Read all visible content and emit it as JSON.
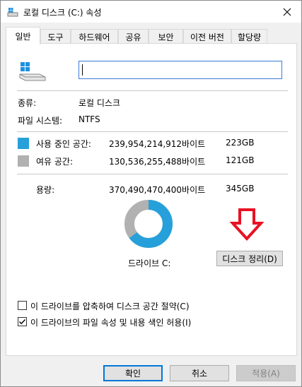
{
  "window": {
    "title": "로컬 디스크 (C:) 속성"
  },
  "tabs": [
    {
      "label": "일반",
      "active": true
    },
    {
      "label": "도구",
      "active": false
    },
    {
      "label": "하드웨어",
      "active": false
    },
    {
      "label": "공유",
      "active": false
    },
    {
      "label": "보안",
      "active": false
    },
    {
      "label": "이전 버전",
      "active": false
    },
    {
      "label": "할당량",
      "active": false
    }
  ],
  "general": {
    "name_value": "",
    "type_label": "종류:",
    "type_value": "로컬 디스크",
    "fs_label": "파일 시스템:",
    "fs_value": "NTFS",
    "used": {
      "label": "사용 중인 공간:",
      "bytes": "239,954,214,912바이트",
      "size": "223GB",
      "color": "#26a0da"
    },
    "free": {
      "label": "여유 공간:",
      "bytes": "130,536,255,488바이트",
      "size": "121GB",
      "color": "#b1b1b1"
    },
    "capacity": {
      "label": "용량:",
      "bytes": "370,490,470,400바이트",
      "size": "345GB"
    },
    "drive_label": "드라이브 C:",
    "cleanup_button": "디스크 정리(D)",
    "used_fraction": 0.6477,
    "compress_label": "이 드라이브를 압축하여 디스크 공간 절약(C)",
    "compress_checked": false,
    "index_label": "이 드라이브의 파일 속성 및 내용 색인 허용(I)",
    "index_checked": true
  },
  "buttons": {
    "ok": "확인",
    "cancel": "취소",
    "apply": "적용(A)"
  },
  "colors": {
    "accent": "#0078d7",
    "arrow": "#e81123"
  },
  "icons": {
    "title": "drive-icon",
    "close": "close-icon",
    "drive": "windows-drive-icon",
    "annotation": "down-arrow-icon"
  }
}
